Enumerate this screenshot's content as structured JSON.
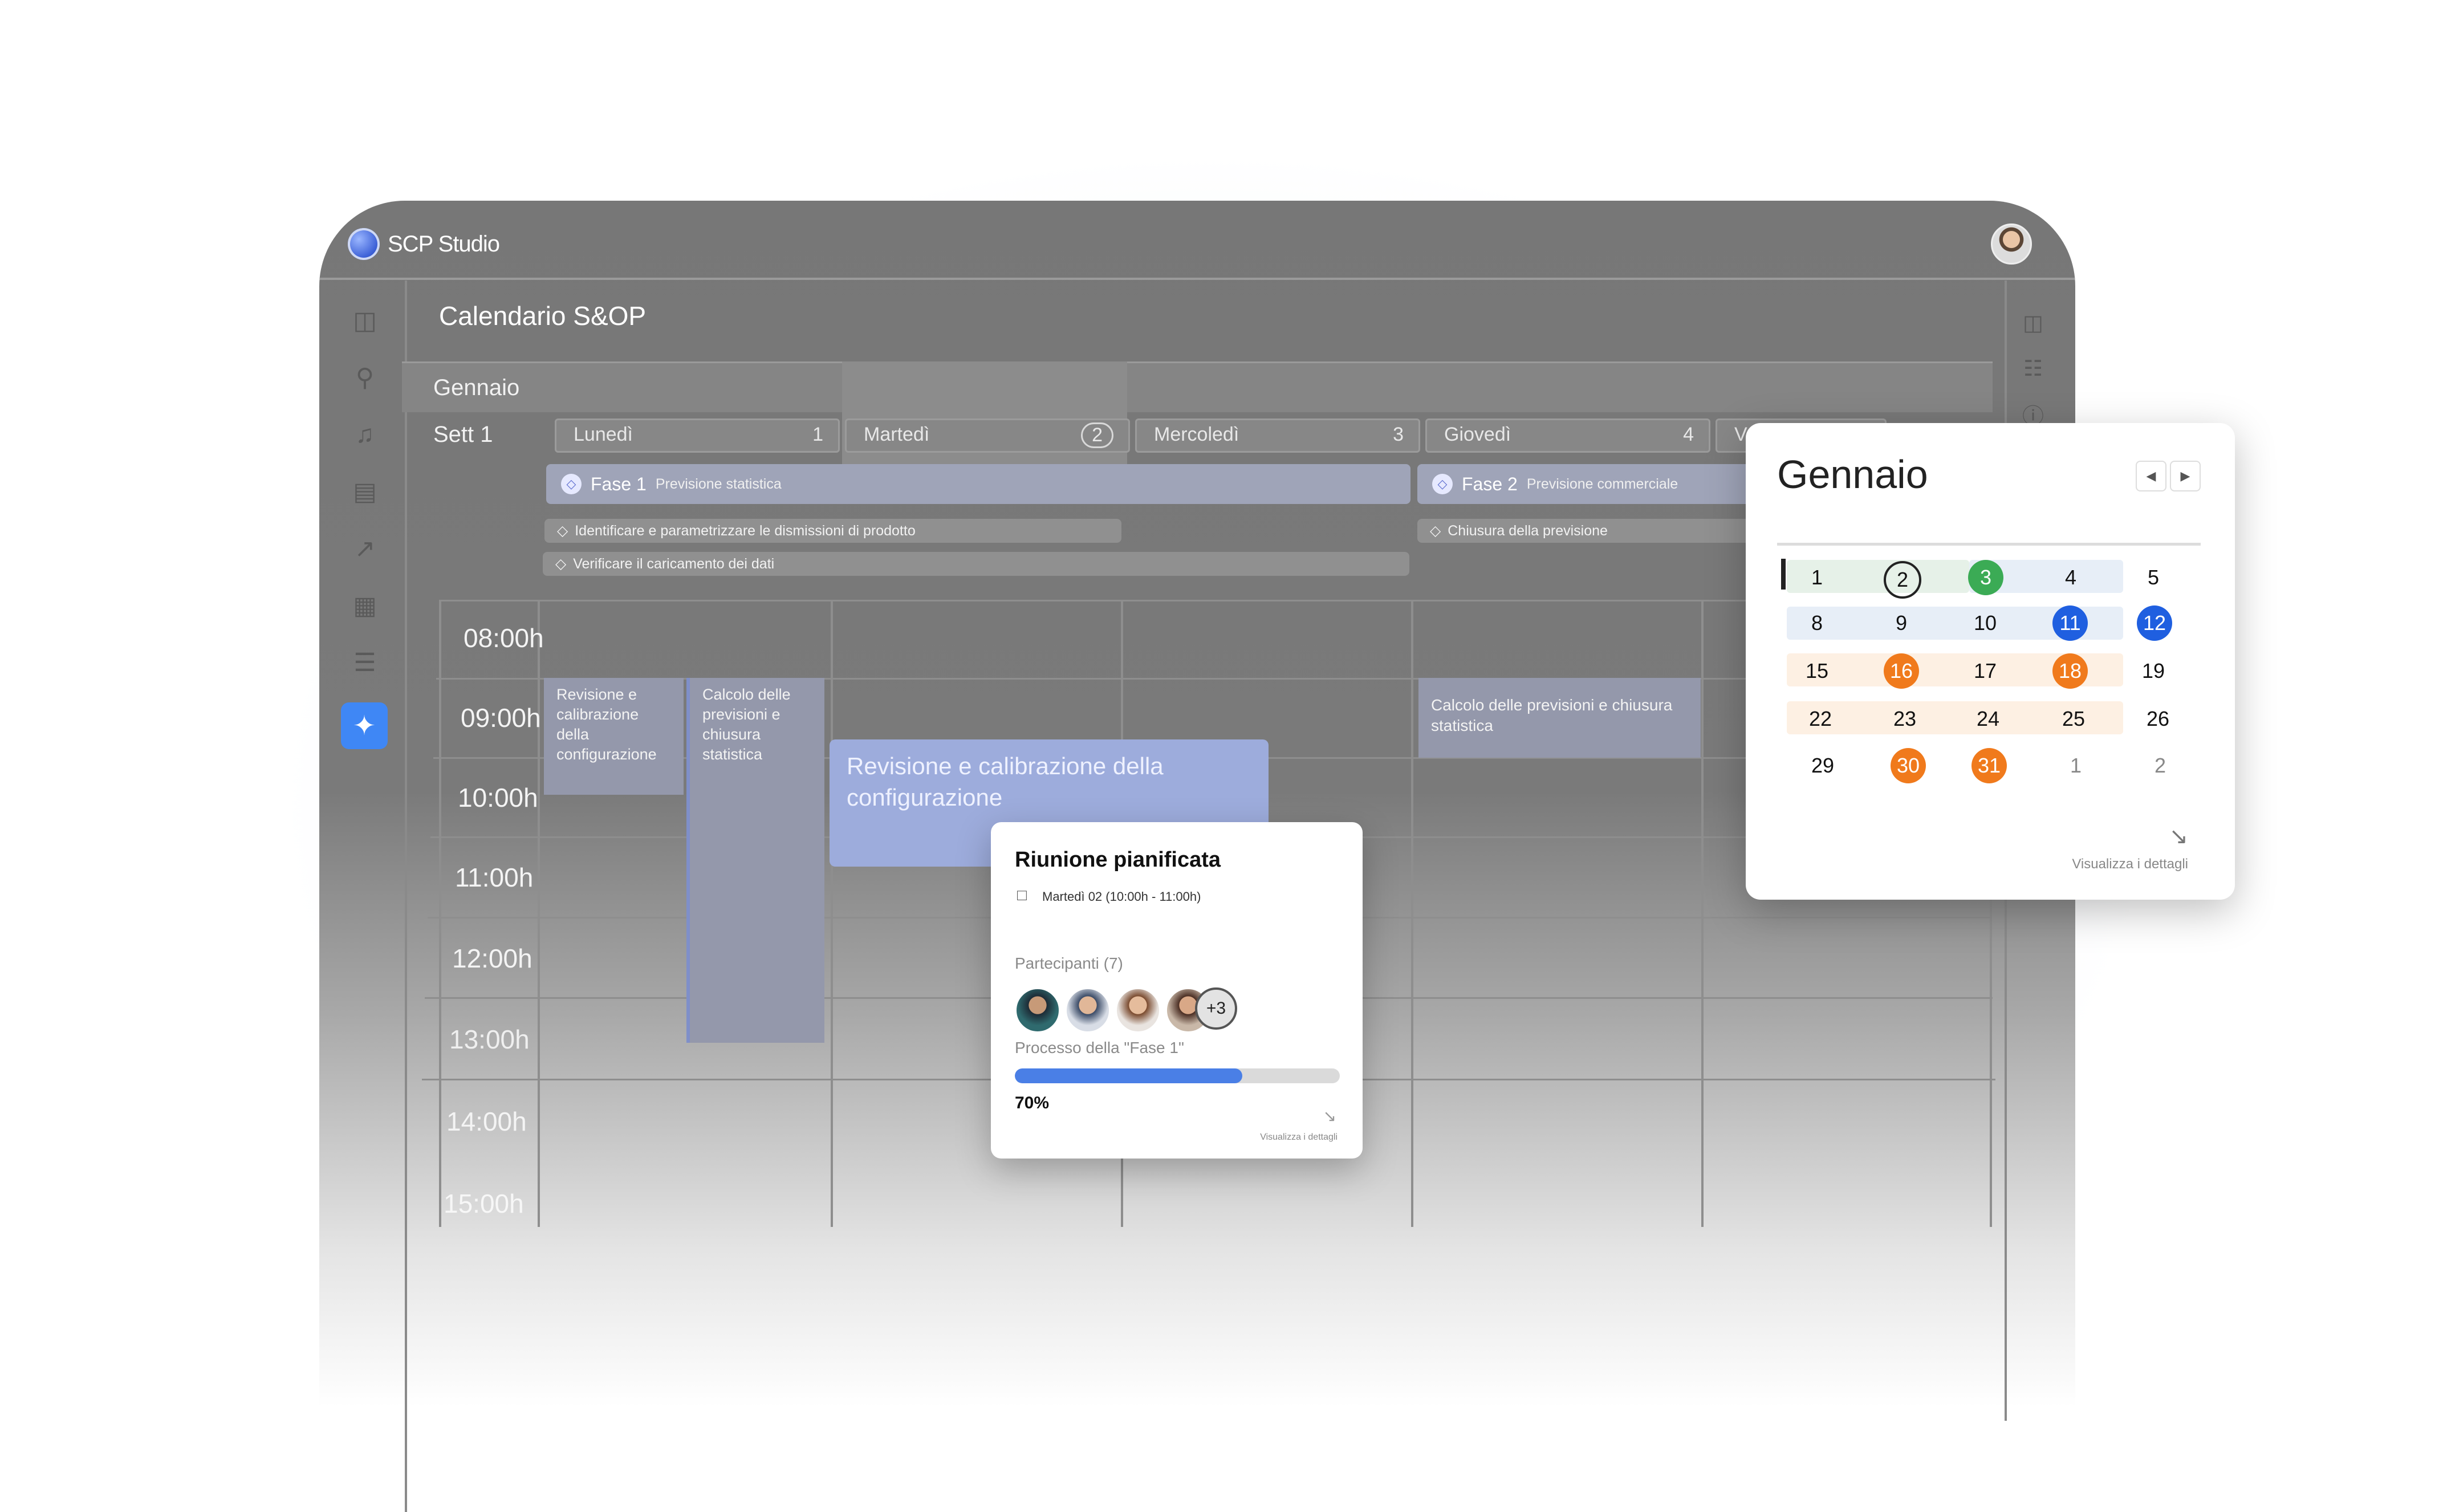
{
  "app": {
    "name": "SCP Studio"
  },
  "page": {
    "title": "Calendario S&OP",
    "month": "Gennaio",
    "week": "Sett 1"
  },
  "days": [
    {
      "name": "Lunedì",
      "num": "1"
    },
    {
      "name": "Martedì",
      "num": "2"
    },
    {
      "name": "Mercoledì",
      "num": "3"
    },
    {
      "name": "Giovedì",
      "num": "4"
    },
    {
      "name": "Ve",
      "num": ""
    }
  ],
  "phases": [
    {
      "name": "Fase 1",
      "sub": "Previsione statistica"
    },
    {
      "name": "Fase 2",
      "sub": "Previsione commerciale"
    }
  ],
  "tasks": [
    "Identificare e parametrizzare le dismissioni di prodotto",
    "Verificare il caricamento dei dati",
    "Chiusura della previsione"
  ],
  "hours": [
    "08:00h",
    "09:00h",
    "10:00h",
    "11:00h",
    "12:00h",
    "13:00h",
    "14:00h",
    "15:00h"
  ],
  "events": [
    "Revisione e calibrazione della configurazione",
    "Calcolo delle previsioni e chiusura statistica",
    "Revisione e calibrazione della configurazione",
    "Calcolo delle previsioni e chiusura statistica"
  ],
  "meeting": {
    "title": "Riunione pianificata",
    "date": "Martedì 02 (10:00h - 11:00h)",
    "participants_label": "Partecipanti (7)",
    "more": "+3",
    "process_label": "Processo della \"Fase 1\"",
    "progress": 70,
    "progress_label": "70%",
    "link": "Visualizza i dettagli"
  },
  "mini_calendar": {
    "title": "Gennaio",
    "weeks": [
      [
        "1",
        "2",
        "3",
        "4",
        "5"
      ],
      [
        "8",
        "9",
        "10",
        "11",
        "12"
      ],
      [
        "15",
        "16",
        "17",
        "18",
        "19"
      ],
      [
        "22",
        "23",
        "24",
        "25",
        "26"
      ],
      [
        "29",
        "30",
        "31",
        "1",
        "2"
      ]
    ],
    "link": "Visualizza i dettagli"
  },
  "colors": {
    "accent_blue": "#1f5fe0",
    "green": "#3bab55",
    "orange": "#f07a1c",
    "progress": "#4a7fe6"
  },
  "icons": [
    "sidebar-toggle-icon",
    "search-icon",
    "bell-icon",
    "document-icon",
    "chart-icon",
    "puzzle-icon",
    "menu-icon",
    "sparkle-icon",
    "panel-icon",
    "excel-icon",
    "info-icon"
  ]
}
